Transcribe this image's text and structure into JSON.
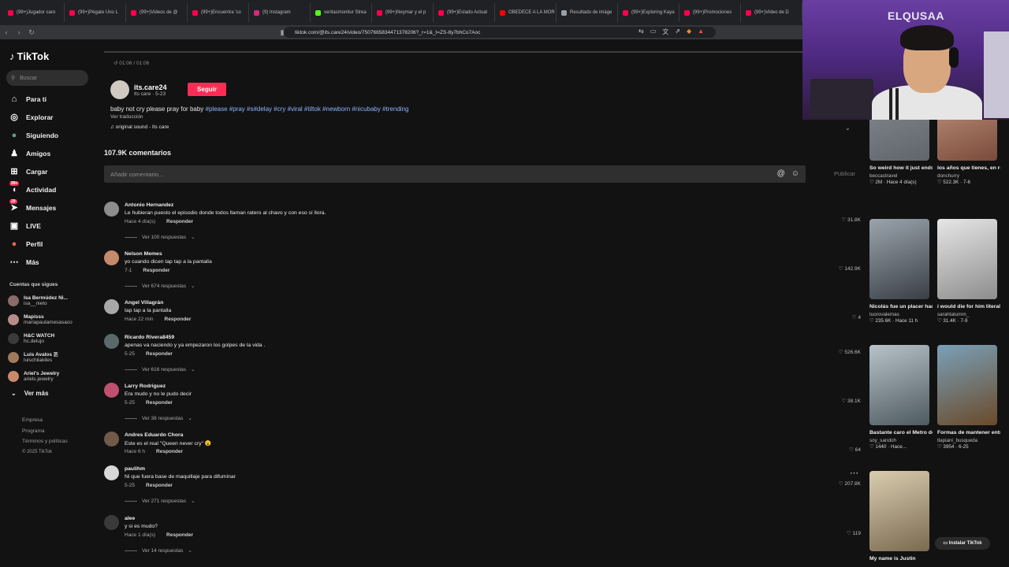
{
  "browser": {
    "tabs": [
      {
        "label": "(99+)Jugador caro",
        "color": "#ff0050"
      },
      {
        "label": "(99+)Pégate Uno L",
        "color": "#ff0050"
      },
      {
        "label": "(99+)Videos de @",
        "color": "#ff0050"
      },
      {
        "label": "(99+)Encuentra 'co",
        "color": "#ff0050"
      },
      {
        "label": "(9) Instagram",
        "color": "#d62976"
      },
      {
        "label": "veritasmonitur Strea",
        "color": "#53fc18"
      },
      {
        "label": "(99+)Neymar y el p",
        "color": "#ff0050"
      },
      {
        "label": "(99+)Estado Actual",
        "color": "#ff0050"
      },
      {
        "label": "OBEDECE A LA MOR",
        "color": "#ff0000"
      },
      {
        "label": "Resultado de imáge",
        "color": "#9aa0a6"
      },
      {
        "label": "(99+)Exploring Kaya",
        "color": "#ff0050"
      },
      {
        "label": "(99+)Promociones",
        "color": "#ff0050"
      },
      {
        "label": "(99+)Video de D",
        "color": "#ff0050"
      }
    ],
    "url": "tiktok.com/@its.care24/video/7507665834471378206?_r=1&_t=ZS-8y7bhCo7Aoc"
  },
  "webcam": {
    "label": "ELQUSAA"
  },
  "sidebar": {
    "logo": "TikTok",
    "search_placeholder": "Buscar",
    "nav": [
      {
        "label": "Para ti",
        "icon": "home-icon",
        "glyph": "⌂"
      },
      {
        "label": "Explorar",
        "icon": "compass-icon",
        "glyph": "◎"
      },
      {
        "label": "Siguiendo",
        "icon": "following-icon",
        "glyph": "●"
      },
      {
        "label": "Amigos",
        "icon": "friends-icon",
        "glyph": "♟"
      },
      {
        "label": "Cargar",
        "icon": "upload-icon",
        "glyph": "⊞"
      },
      {
        "label": "Actividad",
        "icon": "activity-icon",
        "glyph": "◖",
        "badge": "99+"
      },
      {
        "label": "Mensajes",
        "icon": "messages-icon",
        "glyph": "➤",
        "badge": "29"
      },
      {
        "label": "LIVE",
        "icon": "live-icon",
        "glyph": "▣"
      },
      {
        "label": "Perfil",
        "icon": "profile-icon",
        "glyph": "●"
      },
      {
        "label": "Más",
        "icon": "more-icon",
        "glyph": "⋯"
      }
    ],
    "following_title": "Cuentas que sigues",
    "following": [
      {
        "name": "Isa Bermúdez Ni...",
        "user": "isa__nieto"
      },
      {
        "name": "Mapisss",
        "user": "mariapaulamesasaco"
      },
      {
        "name": "H&C WATCH",
        "user": "hc.delujo"
      },
      {
        "name": "Luis Avalos 🇵",
        "user": "luischilakiles"
      },
      {
        "name": "Ariel's Jewelry",
        "user": "ariels.jewelry"
      }
    ],
    "see_more": "Ver más",
    "footer": [
      "Empresa",
      "Programa",
      "Términos y políticas",
      "© 2025 TikTok"
    ]
  },
  "video": {
    "time": "01:06 / 01:06",
    "author_name": "its.care24",
    "author_sub": "Its care · 5-23",
    "follow_label": "Seguir",
    "desc_text": "baby not cry please pray for baby ",
    "desc_tags": "#please #pray #s#delay #cry #viral #tiltok #newborn #nicubaby #trending",
    "translate": "Ver traducción",
    "sound": "♫ original sound - Its care"
  },
  "comments_section": {
    "count": "107.9K comentarios",
    "input_placeholder": "Añadir comentario...",
    "publish": "Publicar",
    "reply_label": "Responder",
    "comments": [
      {
        "name": "Antonio Hernandez",
        "text": "Le hubieran puesto el episodio donde todos llaman ratero al chavo y con eso sí llora.",
        "time": "Hace 4 día(s)",
        "replies": "Ver 100 respuestas",
        "likes": "31.8K"
      },
      {
        "name": "Nelson Memes",
        "text": "yo cuando dicen tap tap a la pantalla",
        "time": "7-1",
        "replies": "Ver 674 respuestas",
        "likes": "142.9K"
      },
      {
        "name": "Angel Villagrán",
        "text": "tap tap a la pantalla",
        "time": "Hace 22 min",
        "replies": "",
        "likes": "4"
      },
      {
        "name": "Ricardo Rivera8459",
        "text": "apenas va naciendo y ya empezaron los golpes de la vida .",
        "time": "5-25",
        "replies": "Ver 616 respuestas",
        "likes": "526.6K"
      },
      {
        "name": "Larry Rodriguez",
        "text": "Era mudo y no le pudo decir",
        "time": "5-25",
        "replies": "Ver 38 respuestas",
        "likes": "38.1K"
      },
      {
        "name": "Andres Eduardo Chora",
        "text": "Este es el real \"Queen never cry\" 😮",
        "time": "Hace 6 h",
        "replies": "",
        "likes": "64"
      },
      {
        "name": "paulihm",
        "text": "Ni que fuera base de maquillaje para difuminar",
        "time": "5-25",
        "replies": "Ver 271 respuestas",
        "likes": "207.8K"
      },
      {
        "name": "alee",
        "text": "y si es mudo?",
        "time": "Hace 1 día(s)",
        "replies": "Ver 14 respuestas",
        "likes": "119"
      }
    ]
  },
  "recommended": [
    {
      "title": "So weird how it just ends on one street!...",
      "user": "beccastravel",
      "stats": "♡ 2M · Hace 4 día(s)"
    },
    {
      "title": "los años que tienes, en realidad son los...",
      "user": "donchurry",
      "stats": "♡ 522.3K · 7-6"
    },
    {
      "title": "Nicolás fue un placer hacer negocios...",
      "user": "tuorovalemas",
      "stats": "♡ 235.6K · Hace 11 h"
    },
    {
      "title": "i would die for him literally love him s...",
      "user": "sarahtatumm_",
      "stats": "♡ 31.4K · 7-9"
    },
    {
      "title": "Bastante caro el Metro de Medellín,...",
      "user": "soy_sandoh",
      "stats": "♡ 1440 · Hace..."
    },
    {
      "title": "Formas de mantener entretenido a tu Ca...",
      "user": "tlapiani_busqueda",
      "stats": "♡ 3954 · 6-25"
    },
    {
      "title": "My name is Justin",
      "user": "",
      "stats": ""
    }
  ],
  "install_label": "Instalar TikTok"
}
